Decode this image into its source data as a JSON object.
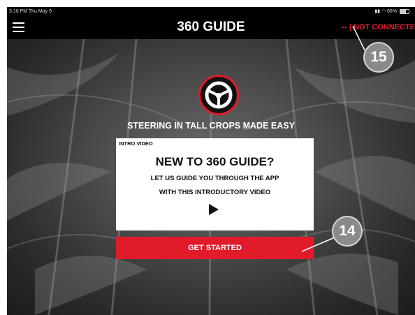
{
  "status_bar": {
    "time": "3:16 PM  Thu May 9",
    "battery": "66%"
  },
  "header": {
    "title": "360 GUIDE",
    "connection_status": "-- | NOT CONNECTE"
  },
  "hero": {
    "tagline": "STEERING IN TALL CROPS MADE EASY"
  },
  "intro_card": {
    "label": "INTRO VIDEO",
    "heading": "NEW TO 360 GUIDE?",
    "line1": "LET US GUIDE YOU THROUGH THE APP",
    "line2": "WITH THIS INTRODUCTORY VIDEO"
  },
  "actions": {
    "get_started": "GET STARTED"
  },
  "callouts": {
    "c15": "15",
    "c14": "14"
  },
  "icons": [
    "menu-icon",
    "wifi-icon",
    "battery-icon",
    "steering-wheel-logo",
    "play-icon"
  ],
  "colors": {
    "accent": "#e21b2a",
    "header_bg": "#000000",
    "callout_bg": "#8a8a8a"
  }
}
